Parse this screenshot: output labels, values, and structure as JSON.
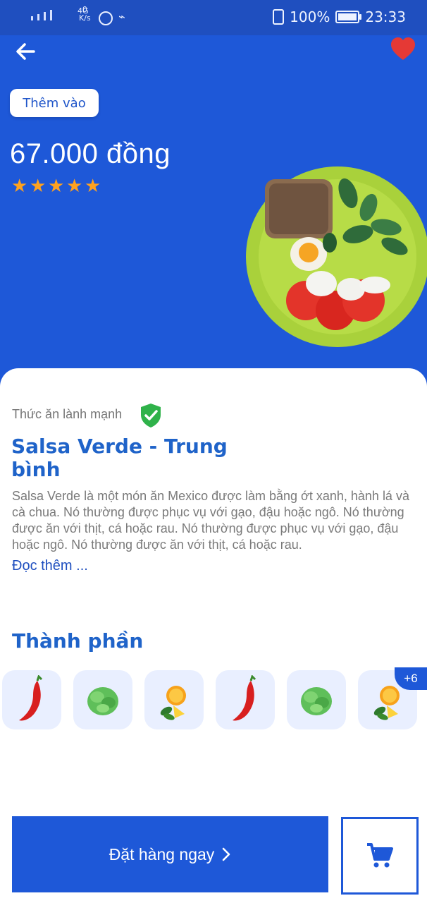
{
  "status_bar": {
    "network_type": "4G",
    "speed_value": "0",
    "speed_unit": "K/s",
    "battery": "100%",
    "time": "23:33"
  },
  "header": {
    "back_icon": "arrow-left-icon",
    "favorite_icon": "heart-icon",
    "add_button_label": "Thêm vào",
    "price": "67.000 đồng",
    "rating_stars": 5
  },
  "product": {
    "category": "Thức ăn lành mạnh",
    "verified_icon": "shield-check-icon",
    "title": "Salsa Verde - Trung bình",
    "description": "Salsa Verde là một món ăn Mexico được làm bằng ớt xanh, hành lá và cà chua. Nó thường được phục vụ với gạo, đậu hoặc ngô. Nó thường được ăn với thịt, cá hoặc rau. Nó thường được phục vụ với gạo, đậu hoặc ngô. Nó thường được ăn với thịt, cá hoặc rau.",
    "read_more": "Đọc thêm ..."
  },
  "ingredients": {
    "section_title": "Thành phần",
    "items": [
      "chili-icon",
      "lettuce-icon",
      "orange-icon",
      "chili-icon",
      "lettuce-icon",
      "orange-icon"
    ],
    "more_badge": "+6"
  },
  "actions": {
    "order_label": "Đặt hàng ngay",
    "order_chevron": "chevron-right-icon",
    "cart_icon": "cart-icon"
  },
  "colors": {
    "primary": "#1e58d8",
    "title_blue": "#1f63c9",
    "star": "#ffa21f",
    "heart": "#e53935",
    "shield": "#2fb24a"
  }
}
